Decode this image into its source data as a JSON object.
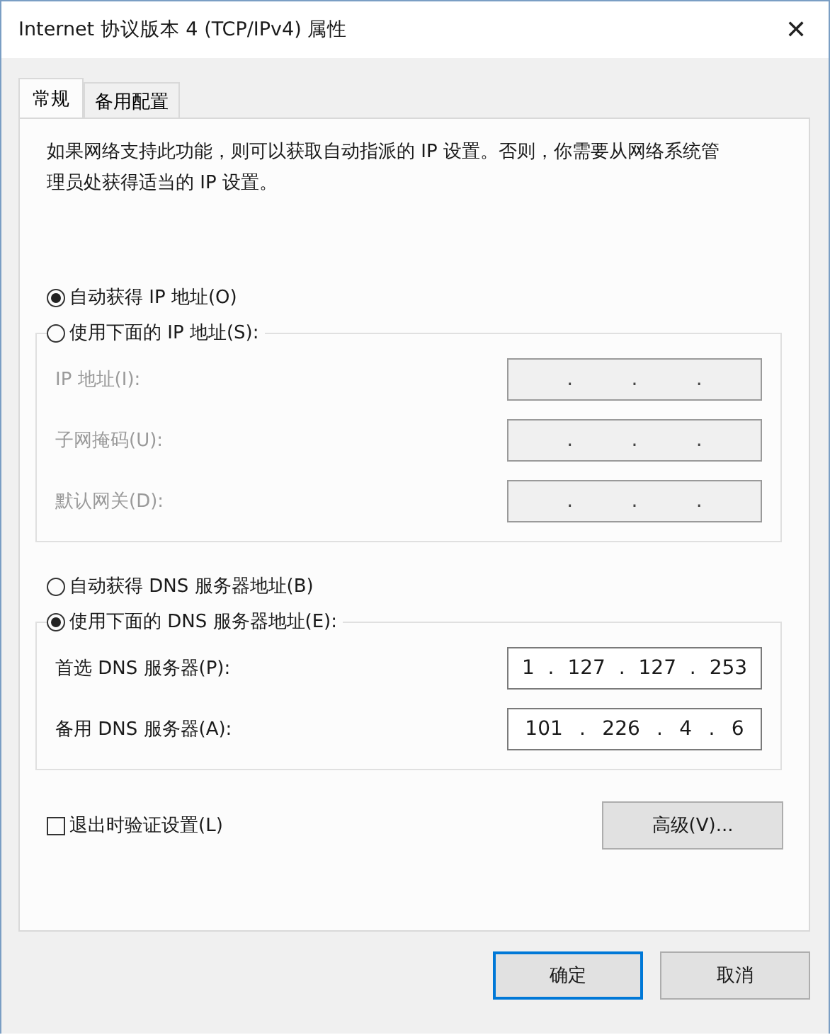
{
  "window": {
    "title": "Internet 协议版本 4 (TCP/IPv4) 属性",
    "close": "✕"
  },
  "tabs": [
    {
      "label": "常规",
      "selected": true
    },
    {
      "label": "备用配置",
      "selected": false
    }
  ],
  "description": "如果网络支持此功能，则可以获取自动指派的 IP 设置。否则，你需要从网络系统管理员处获得适当的 IP 设置。",
  "ip": {
    "auto_option": {
      "label": "自动获得 IP 地址(O)",
      "selected": true
    },
    "manual_option": {
      "label": "使用下面的 IP 地址(S):",
      "selected": false
    },
    "disabled": true,
    "fields": [
      {
        "label": "IP 地址(I):",
        "parts": [
          ".",
          ".",
          "."
        ]
      },
      {
        "label": "子网掩码(U):",
        "parts": [
          ".",
          ".",
          "."
        ]
      },
      {
        "label": "默认网关(D):",
        "parts": [
          ".",
          ".",
          "."
        ]
      }
    ]
  },
  "dns": {
    "auto_option": {
      "label": "自动获得 DNS 服务器地址(B)",
      "selected": false
    },
    "manual_option": {
      "label": "使用下面的 DNS 服务器地址(E):",
      "selected": true
    },
    "disabled": false,
    "fields": [
      {
        "label": "首选 DNS 服务器(P):",
        "parts": [
          "1",
          ".",
          "127",
          ".",
          "127",
          ".",
          "253"
        ]
      },
      {
        "label": "备用 DNS 服务器(A):",
        "parts": [
          "101",
          ".",
          "226",
          ".",
          "4",
          ".",
          "6"
        ]
      }
    ]
  },
  "validate": {
    "label": "退出时验证设置(L)",
    "checked": false
  },
  "advanced_button": "高级(V)...",
  "buttons": [
    {
      "label": "确定",
      "default": true
    },
    {
      "label": "取消",
      "default": false
    }
  ]
}
